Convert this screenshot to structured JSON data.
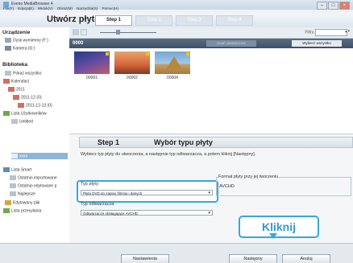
{
  "window": {
    "title": "Everio MediaBrowser 4"
  },
  "menu": [
    "Plik(F)",
    "Edycja(E)",
    "Widok(V)",
    "Obraz(M)",
    "Narzędzia(S)",
    "Pomoc(H)"
  ],
  "header": {
    "title": "Utwórz płytę"
  },
  "steps": [
    "Step 1",
    "Step 2",
    "Step 3",
    "Step 4"
  ],
  "sidebar": {
    "section_device": "Urządzenie",
    "device_items": [
      "Dysk wymienny (F:)",
      "Kamera (G:)"
    ],
    "section_library": "Biblioteka",
    "library_items": [
      "Pokaż wszystko",
      "Kalendarz",
      "2011",
      "2011-12 (0)",
      "2011-12-13 (0)",
      "Lista Użytkowników",
      "Untitled",
      "xxxx",
      "Lista Smart",
      "Ostatnio importowane",
      "Ostatnio edytowane p",
      "Najlepsze",
      "Edytowany plik",
      "Lista przesyłania"
    ]
  },
  "toolbar": {
    "filter_label": "Filtru"
  },
  "content": {
    "header_label": "0000",
    "btn_selected": "Usuń zaznaczone",
    "btn_select_all": "Wybierz wszystko",
    "thumbs": [
      {
        "label": "00001"
      },
      {
        "label": "00002"
      },
      {
        "label": "00004"
      }
    ]
  },
  "step_panel": {
    "step": "Step 1",
    "title": "Wybór typu płyty",
    "instruction": "Wybierz typ płyty do utworzenia, a następnie typ odtwarzacza, a potem kliknij [Następny].",
    "disc_type_label": "Typ płyty:",
    "disc_type_value": "Płyta DVD do zapisu filmów i danych",
    "player_type_label": "Typ odtwarzacza:",
    "player_type_value": "Odtwarzacze obsługujące AVCHD",
    "format_label": "Format płyty przy jej tworzeniu",
    "format_value": "AVCHD",
    "callout": "Kliknij"
  },
  "bottom": {
    "settings": "Nastawienia",
    "next": "Następny",
    "cancel": "Anuluj"
  },
  "colors": {
    "accent": "#35a8dd"
  }
}
